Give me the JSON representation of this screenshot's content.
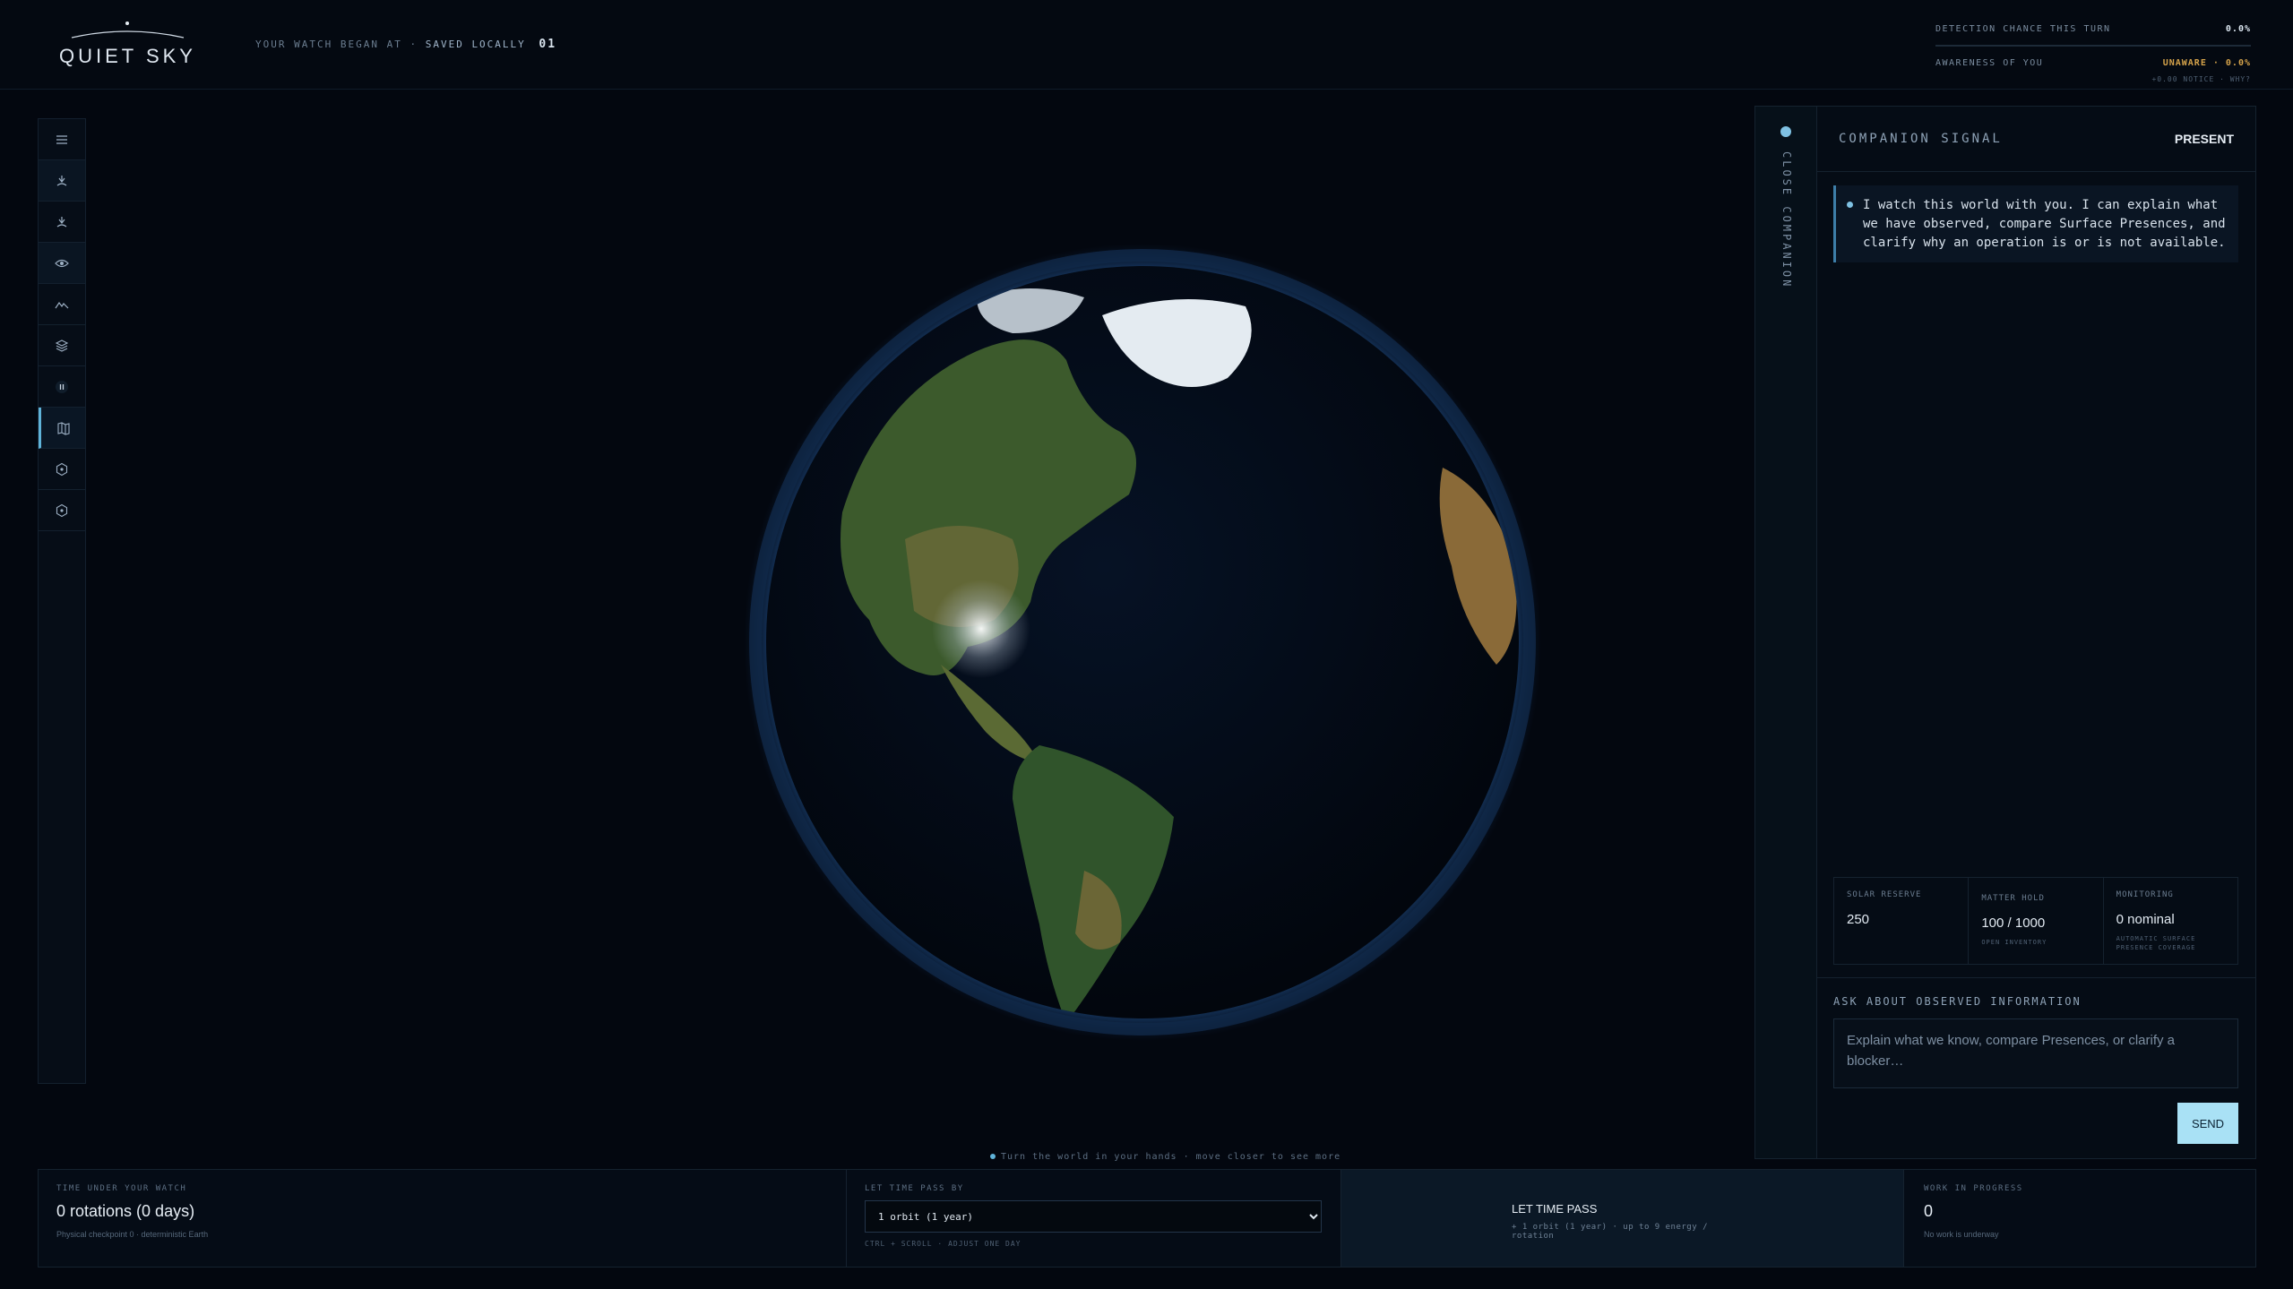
{
  "app": {
    "logo_text": "QUIET SKY",
    "watch_began_label": "YOUR WATCH BEGAN AT ·",
    "saved_label": "SAVED LOCALLY",
    "save_slot": "01"
  },
  "top_stats": {
    "detection_label": "DETECTION CHANCE THIS TURN",
    "detection_value": "0.0%",
    "awareness_label": "AWARENESS OF YOU",
    "awareness_value": "UNAWARE · 0.0%",
    "notice_line": "+0.00 NOTICE · WHY?",
    "accent_color": "#d4a24a"
  },
  "left_rail": {
    "items": [
      {
        "icon": "menu-icon"
      },
      {
        "icon": "probe-icon"
      },
      {
        "icon": "probe-icon"
      },
      {
        "icon": "eye-icon"
      },
      {
        "icon": "terrain-icon"
      },
      {
        "icon": "layers-icon"
      },
      {
        "icon": "pause-icon"
      },
      {
        "icon": "map-icon",
        "active": true
      },
      {
        "icon": "hexagon-icon"
      },
      {
        "icon": "hexagon-icon"
      }
    ]
  },
  "viewport": {
    "hint": "Turn the world in your hands · move closer to see more"
  },
  "companion": {
    "tab_label": "CLOSE COMPANION",
    "title": "COMPANION SIGNAL",
    "status": "PRESENT",
    "message": "I watch this world with you. I can explain what we have observed, compare Surface Presences, and clarify why an operation is or is not available.",
    "resources": {
      "solar_label": "SOLAR RESERVE",
      "solar_value": "250",
      "matter_label": "MATTER HOLD",
      "matter_value": "100 / 1000",
      "matter_sub": "OPEN INVENTORY",
      "monitoring_label": "MONITORING",
      "monitoring_value": "0 nominal",
      "monitoring_sub": "AUTOMATIC SURFACE PRESENCE COVERAGE"
    },
    "ask_label": "ASK ABOUT OBSERVED INFORMATION",
    "ask_placeholder": "Explain what we know, compare Presences, or clarify a blocker…",
    "send_label": "SEND"
  },
  "bottom": {
    "time_label": "TIME UNDER YOUR WATCH",
    "time_value": "0 rotations (0 days)",
    "time_sub": "Physical checkpoint 0 · deterministic Earth",
    "pace_label": "LET TIME PASS BY",
    "pace_selected": "1 orbit (1 year)",
    "pace_hint": "CTRL + SCROLL · ADJUST ONE DAY",
    "pass_title": "LET TIME PASS",
    "pass_sub": "+ 1 orbit (1 year) · up to 9 energy / rotation",
    "work_label": "WORK IN PROGRESS",
    "work_value": "0",
    "work_sub": "No work is underway"
  }
}
